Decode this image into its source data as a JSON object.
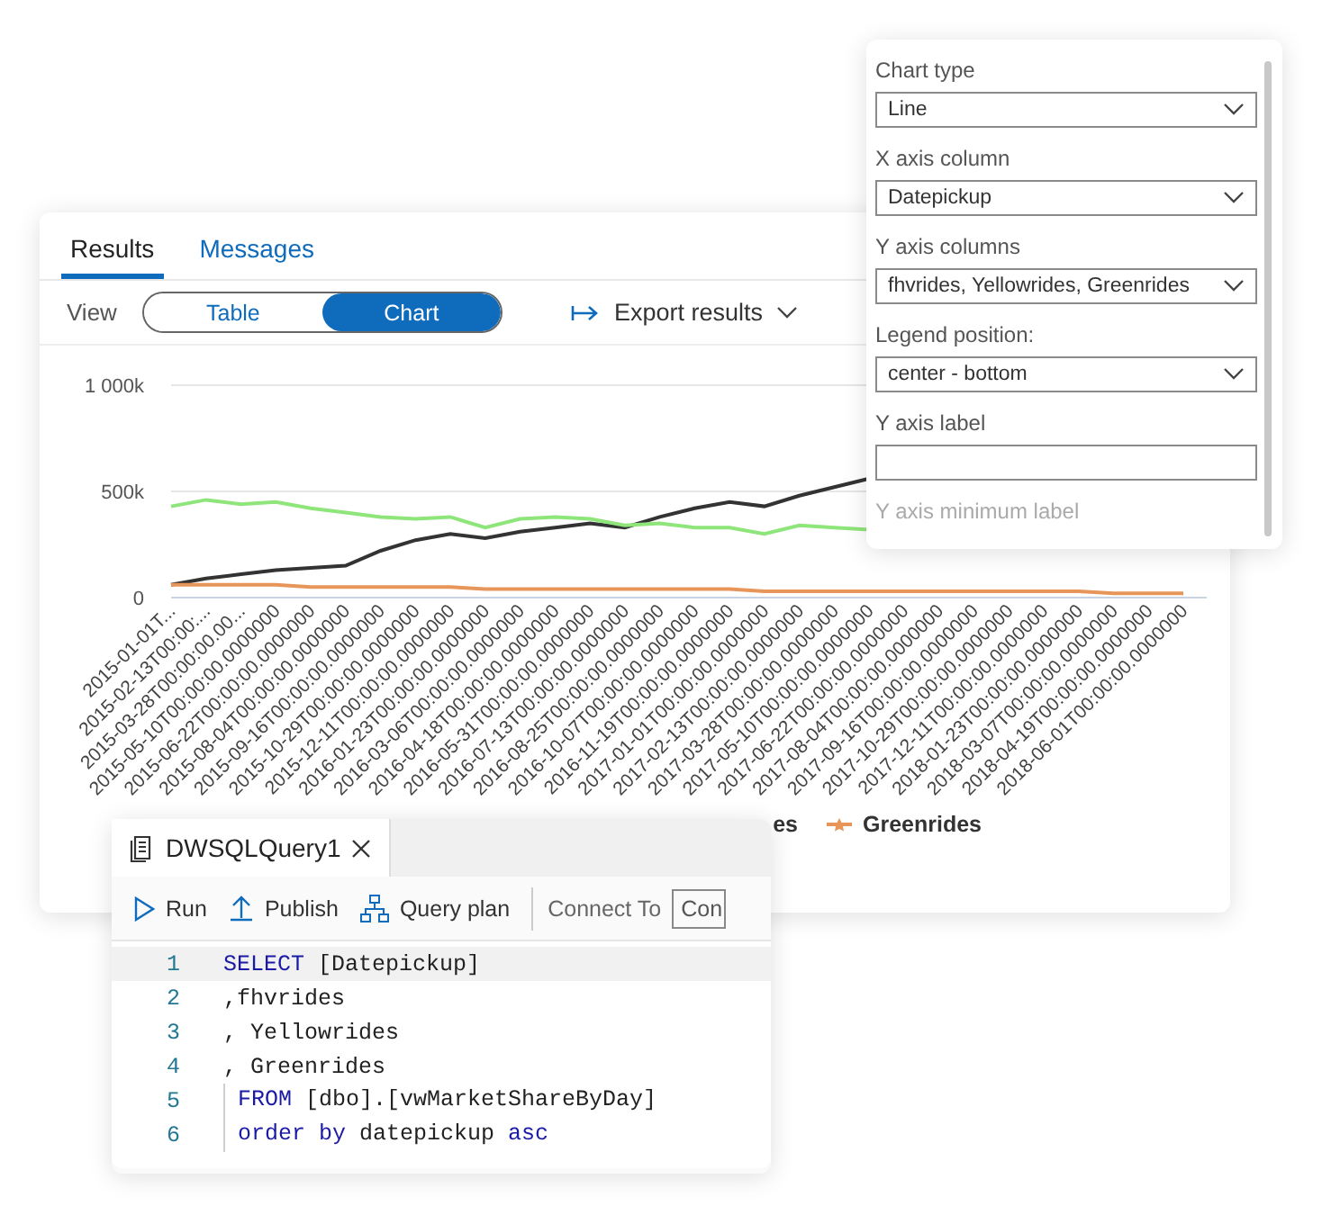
{
  "results_window": {
    "tabs": [
      {
        "label": "Results",
        "selected": true
      },
      {
        "label": "Messages",
        "selected": false
      }
    ],
    "view": {
      "label": "View",
      "options": [
        {
          "label": "Table",
          "selected": false
        },
        {
          "label": "Chart",
          "selected": true
        }
      ]
    },
    "export": {
      "label": "Export results"
    },
    "chart_data": {
      "type": "line",
      "categories": [
        "2015-01-01T...",
        "2015-02-13T00:00:...",
        "2015-03-28T00:00:00.00...",
        "2015-05-10T00:00:00.0000000",
        "2015-06-22T00:00:00.0000000",
        "2015-08-04T00:00:00.0000000",
        "2015-09-16T00:00:00.0000000",
        "2015-10-29T00:00:00.0000000",
        "2015-12-11T00:00:00.0000000",
        "2016-01-23T00:00:00.0000000",
        "2016-03-06T00:00:00.0000000",
        "2016-04-18T00:00:00.0000000",
        "2016-05-31T00:00:00.0000000",
        "2016-07-13T00:00:00.0000000",
        "2016-08-25T00:00:00.0000000",
        "2016-10-07T00:00:00.0000000",
        "2016-11-19T00:00:00.0000000",
        "2017-01-01T00:00:00.0000000",
        "2017-02-13T00:00:00.0000000",
        "2017-03-28T00:00:00.0000000",
        "2017-05-10T00:00:00.0000000",
        "2017-06-22T00:00:00.0000000",
        "2017-08-04T00:00:00.0000000",
        "2017-09-16T00:00:00.0000000",
        "2017-10-29T00:00:00.0000000",
        "2017-12-11T00:00:00.0000000",
        "2018-01-23T00:00:00.0000000",
        "2018-03-07T00:00:00.0000000",
        "2018-04-19T00:00:00.0000000",
        "2018-06-01T00:00:00.0000000"
      ],
      "series": [
        {
          "color": "#333333",
          "values": [
            60000,
            90000,
            110000,
            130000,
            140000,
            150000,
            220000,
            270000,
            300000,
            280000,
            310000,
            330000,
            350000,
            330000,
            380000,
            420000,
            450000,
            430000,
            480000,
            520000,
            560000,
            null,
            null,
            null,
            null,
            null,
            null,
            null,
            null,
            null
          ]
        },
        {
          "color": "#8ee57a",
          "values": [
            430000,
            460000,
            440000,
            450000,
            420000,
            400000,
            380000,
            370000,
            380000,
            330000,
            370000,
            380000,
            370000,
            340000,
            350000,
            330000,
            330000,
            300000,
            340000,
            330000,
            320000,
            null,
            null,
            null,
            null,
            null,
            null,
            null,
            null,
            null
          ]
        },
        {
          "name": "Greenrides",
          "color": "#e8955a",
          "values": [
            60000,
            60000,
            60000,
            60000,
            50000,
            50000,
            50000,
            50000,
            50000,
            40000,
            40000,
            40000,
            40000,
            40000,
            40000,
            40000,
            40000,
            30000,
            30000,
            30000,
            30000,
            30000,
            30000,
            30000,
            30000,
            30000,
            30000,
            20000,
            20000,
            20000
          ]
        }
      ],
      "ylim": [
        0,
        1000000
      ],
      "yticks": [
        {
          "value": 0,
          "label": "0"
        },
        {
          "value": 500000,
          "label": "500k"
        },
        {
          "value": 1000000,
          "label": "1 000k"
        }
      ]
    },
    "legend_fragment": "es"
  },
  "chart_settings": {
    "fields": [
      {
        "label": "Chart type",
        "kind": "select",
        "value": "Line"
      },
      {
        "label": "X axis column",
        "kind": "select",
        "value": "Datepickup"
      },
      {
        "label": "Y axis columns",
        "kind": "select",
        "value": "fhvrides, Yellowrides, Greenrides"
      },
      {
        "label": "Legend position:",
        "kind": "select",
        "value": "center - bottom"
      },
      {
        "label": "Y axis label",
        "kind": "text"
      },
      {
        "label": "Y axis minimum label",
        "kind": "cut"
      }
    ]
  },
  "query_window": {
    "tab": {
      "title": "DWSQLQuery1"
    },
    "toolbar": [
      {
        "label": "Run",
        "kind": "run"
      },
      {
        "label": "Publish",
        "kind": "publish"
      },
      {
        "label": "Query plan",
        "kind": "plan"
      }
    ],
    "connect": {
      "label": "Connect To",
      "value": "Con"
    },
    "lines": [
      {
        "number": "1",
        "highlighted": true,
        "indent": false,
        "tokens": [
          {
            "text": "SELECT",
            "kind": "keyword"
          },
          {
            "text": " [Datepickup]",
            "kind": "plain"
          }
        ]
      },
      {
        "number": "2",
        "highlighted": false,
        "indent": false,
        "tokens": [
          {
            "text": ",fhvrides",
            "kind": "plain"
          }
        ]
      },
      {
        "number": "3",
        "highlighted": false,
        "indent": false,
        "tokens": [
          {
            "text": ", Yellowrides",
            "kind": "plain"
          }
        ]
      },
      {
        "number": "4",
        "highlighted": false,
        "indent": false,
        "tokens": [
          {
            "text": ", Greenrides",
            "kind": "plain"
          }
        ]
      },
      {
        "number": "5",
        "highlighted": false,
        "indent": true,
        "tokens": [
          {
            "text": "FROM",
            "kind": "keyword"
          },
          {
            "text": " [dbo].[vwMarketShareByDay]",
            "kind": "plain"
          }
        ]
      },
      {
        "number": "6",
        "highlighted": false,
        "indent": true,
        "tokens": [
          {
            "text": "order by",
            "kind": "keyword"
          },
          {
            "text": " datepickup ",
            "kind": "plain"
          },
          {
            "text": "asc",
            "kind": "keyword"
          }
        ]
      }
    ]
  }
}
